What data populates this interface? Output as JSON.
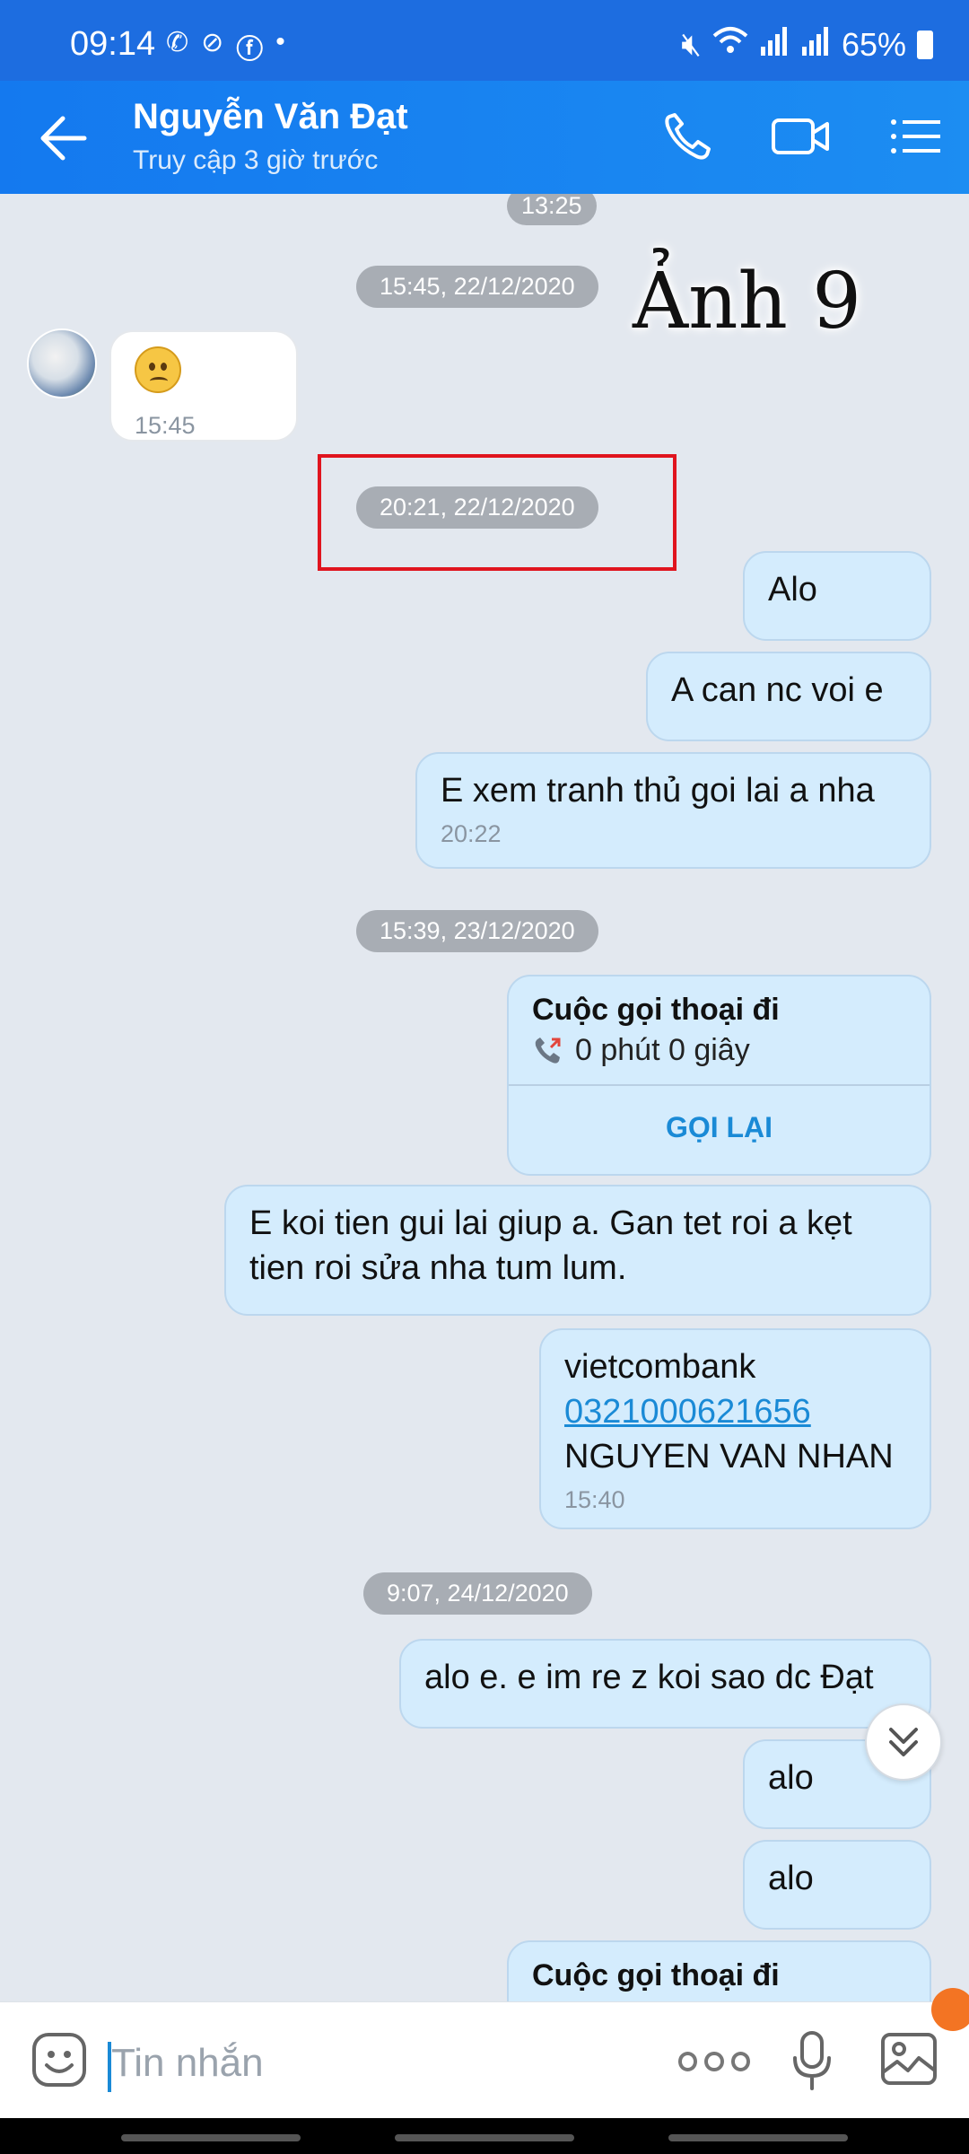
{
  "status_bar": {
    "time": "09:14",
    "battery": "65%"
  },
  "header": {
    "name": "Nguyễn Văn Đạt",
    "status": "Truy cập 3 giờ trước"
  },
  "overlay": {
    "label": "Ảnh 9"
  },
  "chat": {
    "top_time": "13:25",
    "sep1": "15:45, 22/12/2020",
    "incoming": {
      "time": "15:45"
    },
    "sep2": "20:21, 22/12/2020",
    "msg_alo": "Alo",
    "msg_can_nc": "A can nc voi e",
    "msg_xem": "E xem tranh thủ goi lai a nha",
    "msg_xem_time": "20:22",
    "sep3": "15:39, 23/12/2020",
    "call1": {
      "title": "Cuộc gọi thoại đi",
      "duration": "0 phút 0 giây",
      "action": "GỌI LẠI"
    },
    "msg_koi_tien": "E koi tien gui lai giup a. Gan tet roi a kẹt tien roi sửa nha tum lum.",
    "bank": {
      "name": "vietcombank",
      "account": "0321000621656",
      "holder": "NGUYEN VAN NHAN",
      "time": "15:40"
    },
    "sep4": "9:07, 24/12/2020",
    "msg_alo_e": "alo e. e im re z koi sao dc Đạt",
    "msg_alo2": "alo",
    "msg_alo3": "alo",
    "call2": {
      "title": "Cuộc gọi thoại đi"
    }
  },
  "input": {
    "placeholder": "Tin nhắn"
  },
  "colors": {
    "header": "#1a82ef",
    "bubble_out": "#d4ecfd",
    "chat_bg": "#e3e8ef",
    "link": "#1a8ad6",
    "highlight_box": "#e0141e"
  }
}
